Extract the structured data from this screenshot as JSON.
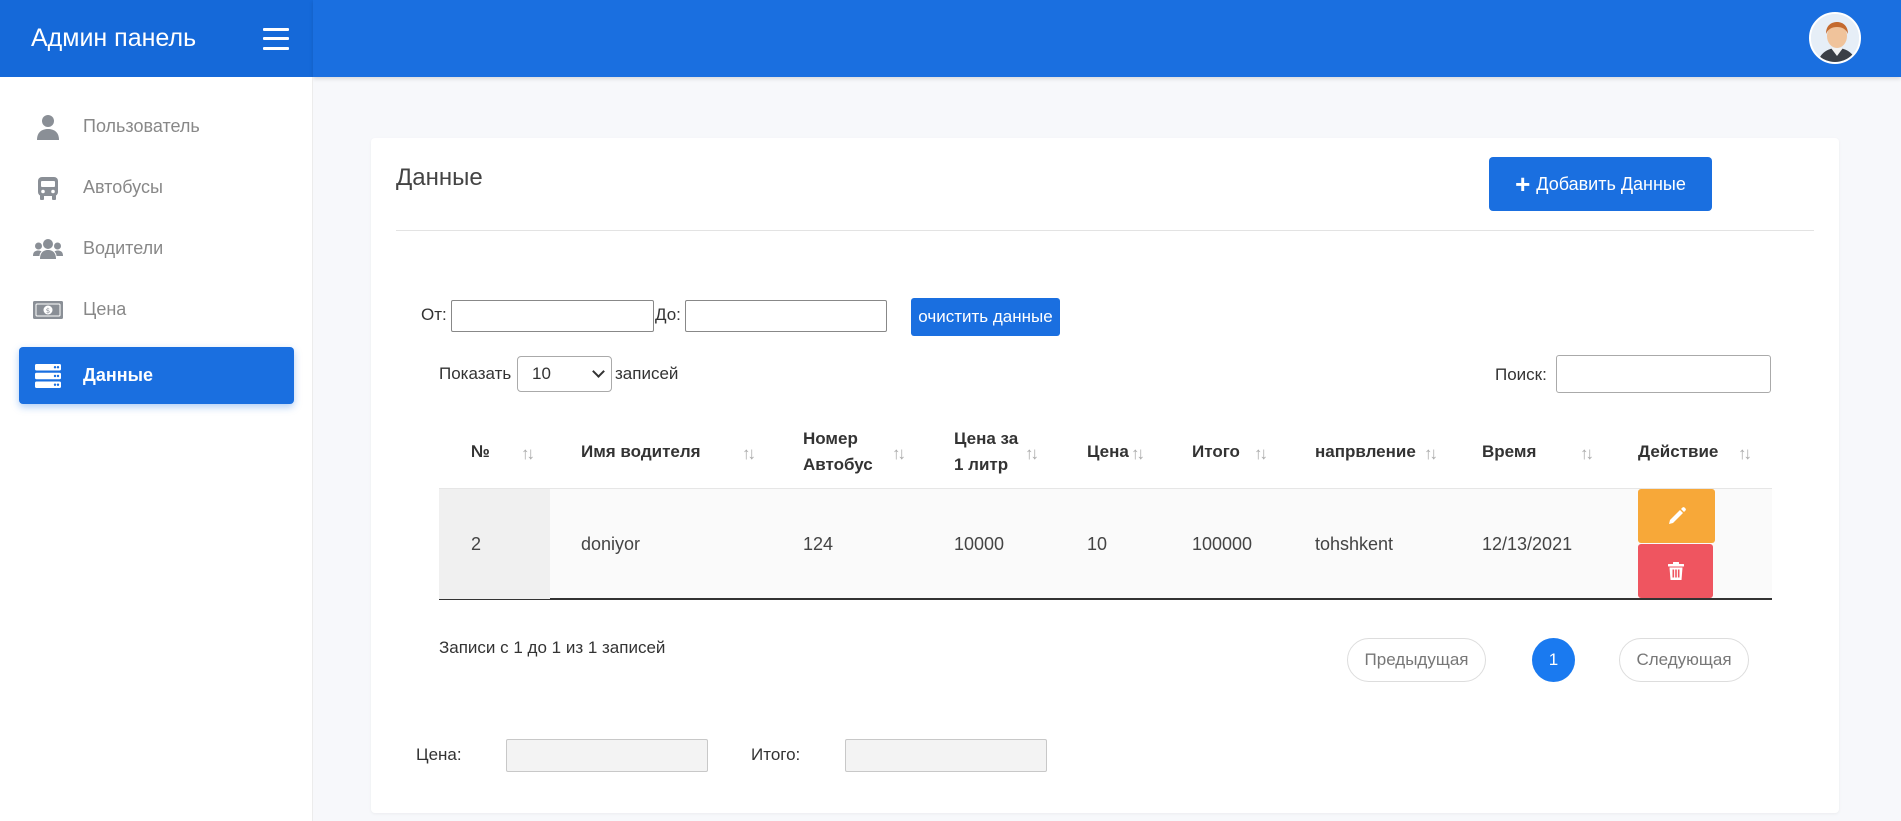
{
  "brand": {
    "title": "Админ панель"
  },
  "sidebar": {
    "items": [
      {
        "label": "Пользователь",
        "icon": "user-icon"
      },
      {
        "label": "Автобусы",
        "icon": "bus-icon"
      },
      {
        "label": "Водители",
        "icon": "users-icon"
      },
      {
        "label": "Цена",
        "icon": "money-icon"
      },
      {
        "label": "Данные",
        "icon": "database-icon",
        "active": true
      }
    ]
  },
  "card": {
    "title": "Данные",
    "add_button": "Добавить Данные"
  },
  "filter": {
    "from_label": "От:",
    "to_label": "До:",
    "from_value": "",
    "to_value": "",
    "clear_button": "очистить данные"
  },
  "table_controls": {
    "show_label": "Показать",
    "page_size": "10",
    "entries_label": "записей",
    "search_label": "Поиск:",
    "search_value": ""
  },
  "table": {
    "headers": [
      {
        "line1": "№",
        "line2": ""
      },
      {
        "line1": "Имя водителя",
        "line2": ""
      },
      {
        "line1": "Номер",
        "line2": "Автобус"
      },
      {
        "line1": "Цена за",
        "line2": "1 литр"
      },
      {
        "line1": "Цена",
        "line2": ""
      },
      {
        "line1": "Итого",
        "line2": ""
      },
      {
        "line1": "напрвление",
        "line2": ""
      },
      {
        "line1": "Время",
        "line2": ""
      },
      {
        "line1": "Действие",
        "line2": ""
      }
    ],
    "rows": [
      [
        "2",
        "doniyor",
        "124",
        "10000",
        "10",
        "100000",
        "tohshkent",
        "12/13/2021"
      ]
    ]
  },
  "pagination": {
    "info": "Записи с 1 до 1 из 1 записей",
    "prev": "Предыдущая",
    "page": "1",
    "next": "Следующая"
  },
  "totals": {
    "price_label": "Цена:",
    "total_label": "Итого:",
    "price_value": "",
    "total_value": ""
  },
  "colors": {
    "primary": "#1a6fe0",
    "edit": "#f7a839",
    "delete": "#ef5560"
  }
}
